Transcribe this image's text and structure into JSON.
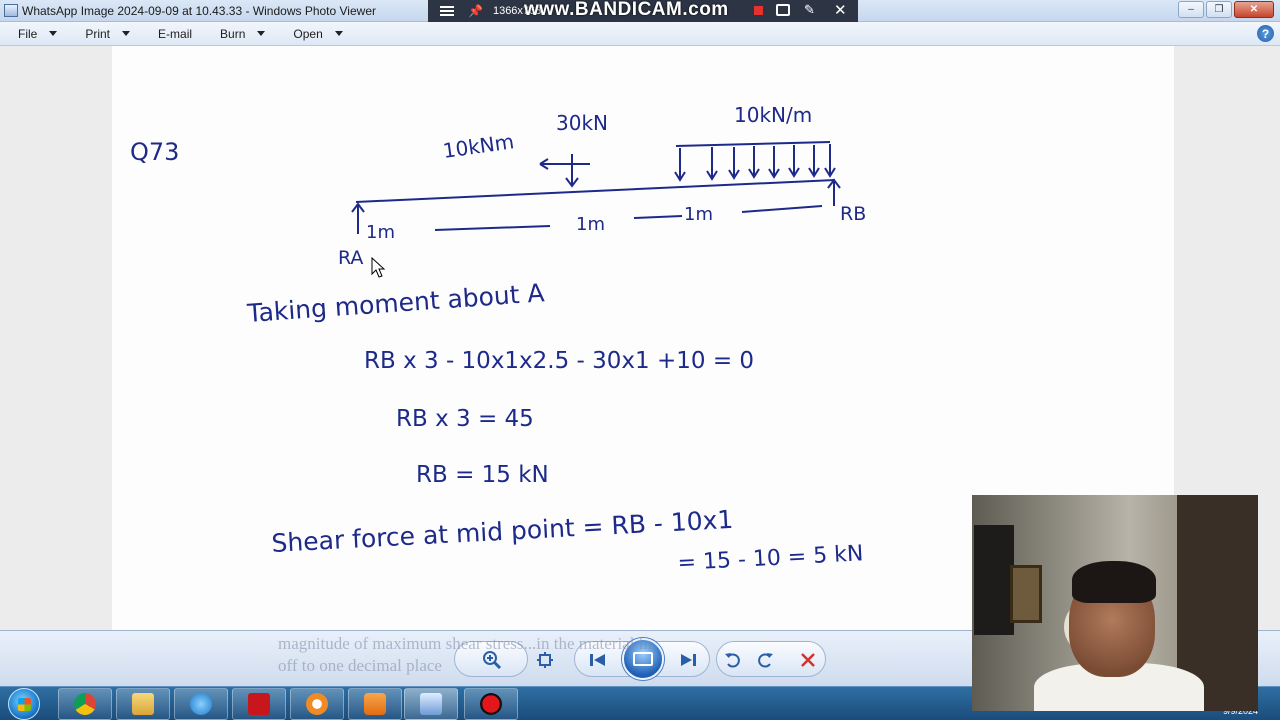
{
  "window": {
    "title": "WhatsApp Image 2024-09-09 at 10.43.33 - Windows Photo Viewer",
    "minimize_symbol": "–",
    "maximize_symbol": "❒",
    "close_symbol": "✕"
  },
  "recorder_overlay": {
    "resolution": "1366x768",
    "watermark": "www.BANDICAM.com",
    "icons": [
      "menu-icon",
      "pin-icon",
      "record-stop-icon",
      "camera-icon",
      "pen-icon",
      "close-icon"
    ]
  },
  "menu": {
    "items": [
      {
        "label": "File",
        "has_dropdown": true
      },
      {
        "label": "Print",
        "has_dropdown": true
      },
      {
        "label": "E-mail",
        "has_dropdown": false
      },
      {
        "label": "Burn",
        "has_dropdown": true
      },
      {
        "label": "Open",
        "has_dropdown": true
      }
    ],
    "help_symbol": "?"
  },
  "notes": {
    "question_no": "Q73",
    "load_moment": "10kNm",
    "load_point": "30kN",
    "load_udl": "10kN/m",
    "support_left": "RA",
    "support_right": "RB",
    "spans": [
      "1m",
      "1m",
      "1m"
    ],
    "lines": [
      "Taking moment about A",
      "RB x 3   - 10x1x2.5 - 30x1 +10 = 0",
      "RB x 3 = 45",
      "RB = 15 kN",
      "Shear force at mid point   = RB - 10x1",
      "= 15 - 10 = 5 kN"
    ]
  },
  "background_text": {
    "line1": "magnitude of maximum shear stress...in the material in",
    "line2": "off to one decimal place"
  },
  "controls": {
    "icons": [
      "zoom-icon",
      "fit-window-icon",
      "previous-icon",
      "slideshow-icon",
      "next-icon",
      "rotate-counterclockwise-icon",
      "rotate-clockwise-icon",
      "delete-icon"
    ]
  },
  "taskbar": {
    "apps": [
      "chrome-icon",
      "file-explorer-icon",
      "internet-explorer-icon",
      "acrobat-icon",
      "pdf-reader-icon",
      "media-player-icon",
      "photo-viewer-icon",
      "bandicam-icon"
    ],
    "date": "9/9/2024"
  },
  "colors": {
    "ink": "#1d2a8a",
    "titlebar": "#c6d7ee",
    "taskbar": "#1a4c7c",
    "delete": "#d0342c"
  }
}
